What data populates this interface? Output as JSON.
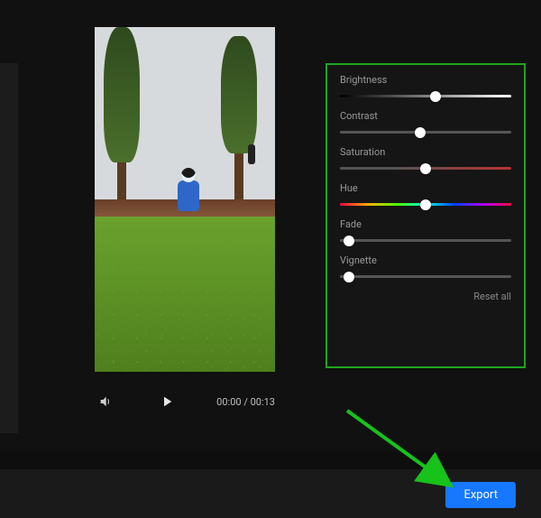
{
  "player": {
    "current_time": "00:00",
    "separator": "/",
    "total_time": "00:13"
  },
  "adjustments": {
    "brightness": {
      "label": "Brightness",
      "value": 56
    },
    "contrast": {
      "label": "Contrast",
      "value": 47
    },
    "saturation": {
      "label": "Saturation",
      "value": 50
    },
    "hue": {
      "label": "Hue",
      "value": 50
    },
    "fade": {
      "label": "Fade",
      "value": 5
    },
    "vignette": {
      "label": "Vignette",
      "value": 5
    },
    "reset_label": "Reset all"
  },
  "actions": {
    "export_label": "Export"
  },
  "colors": {
    "accent": "#1677ff",
    "highlight_border": "#1fa51f"
  }
}
